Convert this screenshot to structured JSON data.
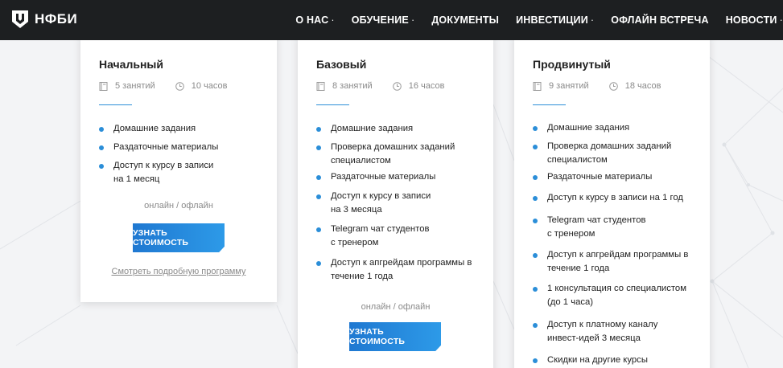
{
  "header": {
    "logo_text": "НФБИ",
    "nav": [
      {
        "label": "О НАС",
        "dropdown": true
      },
      {
        "label": "ОБУЧЕНИЕ",
        "dropdown": true
      },
      {
        "label": "ДОКУМЕНТЫ",
        "dropdown": false
      },
      {
        "label": "ИНВЕСТИЦИИ",
        "dropdown": true
      },
      {
        "label": "ОФЛАЙН ВСТРЕЧА",
        "dropdown": false
      },
      {
        "label": "НОВОСТИ",
        "dropdown": true
      }
    ],
    "dropdown_marker": "·"
  },
  "colors": {
    "accent": "#2b8ed8",
    "header_bg": "#1d1f21",
    "button_from": "#1f78d1",
    "button_to": "#2d9ae8"
  },
  "icons": {
    "lessons": "book-icon",
    "hours": "clock-icon"
  },
  "cards": [
    {
      "title": "Начальный",
      "lessons": "5 занятий",
      "hours": "10 часов",
      "features": [
        "Домашние задания",
        "Раздаточные материалы",
        "Доступ к курсу в записи\nна 1 месяц"
      ],
      "format": "онлайн / офлайн",
      "cta": "УЗНАТЬ СТОИМОСТЬ",
      "link": "Смотреть подробную программу"
    },
    {
      "title": "Базовый",
      "lessons": "8 занятий",
      "hours": "16 часов",
      "features": [
        "Домашние задания",
        "Проверка домашних заданий\nспециалистом",
        "Раздаточные материалы",
        "Доступ к курсу в записи\nна 3 месяца",
        "Telegram чат студентов\nс тренером",
        "Доступ к апгрейдам программы в\nтечение 1 года"
      ],
      "format": "онлайн / офлайн",
      "cta": "УЗНАТЬ СТОИМОСТЬ"
    },
    {
      "title": "Продвинутый",
      "lessons": "9 занятий",
      "hours": "18 часов",
      "features": [
        "Домашние задания",
        "Проверка домашних заданий\nспециалистом",
        "Раздаточные материалы",
        "Доступ к курсу в записи на 1 год",
        "Telegram чат студентов\nс тренером",
        "Доступ к апгрейдам программы в\nтечение 1 года",
        "1 консультация со специалистом\n(до 1 часа)",
        "Доступ к платному каналу\nинвест-идей 3 месяца",
        "Скидки на другие курсы"
      ]
    }
  ]
}
